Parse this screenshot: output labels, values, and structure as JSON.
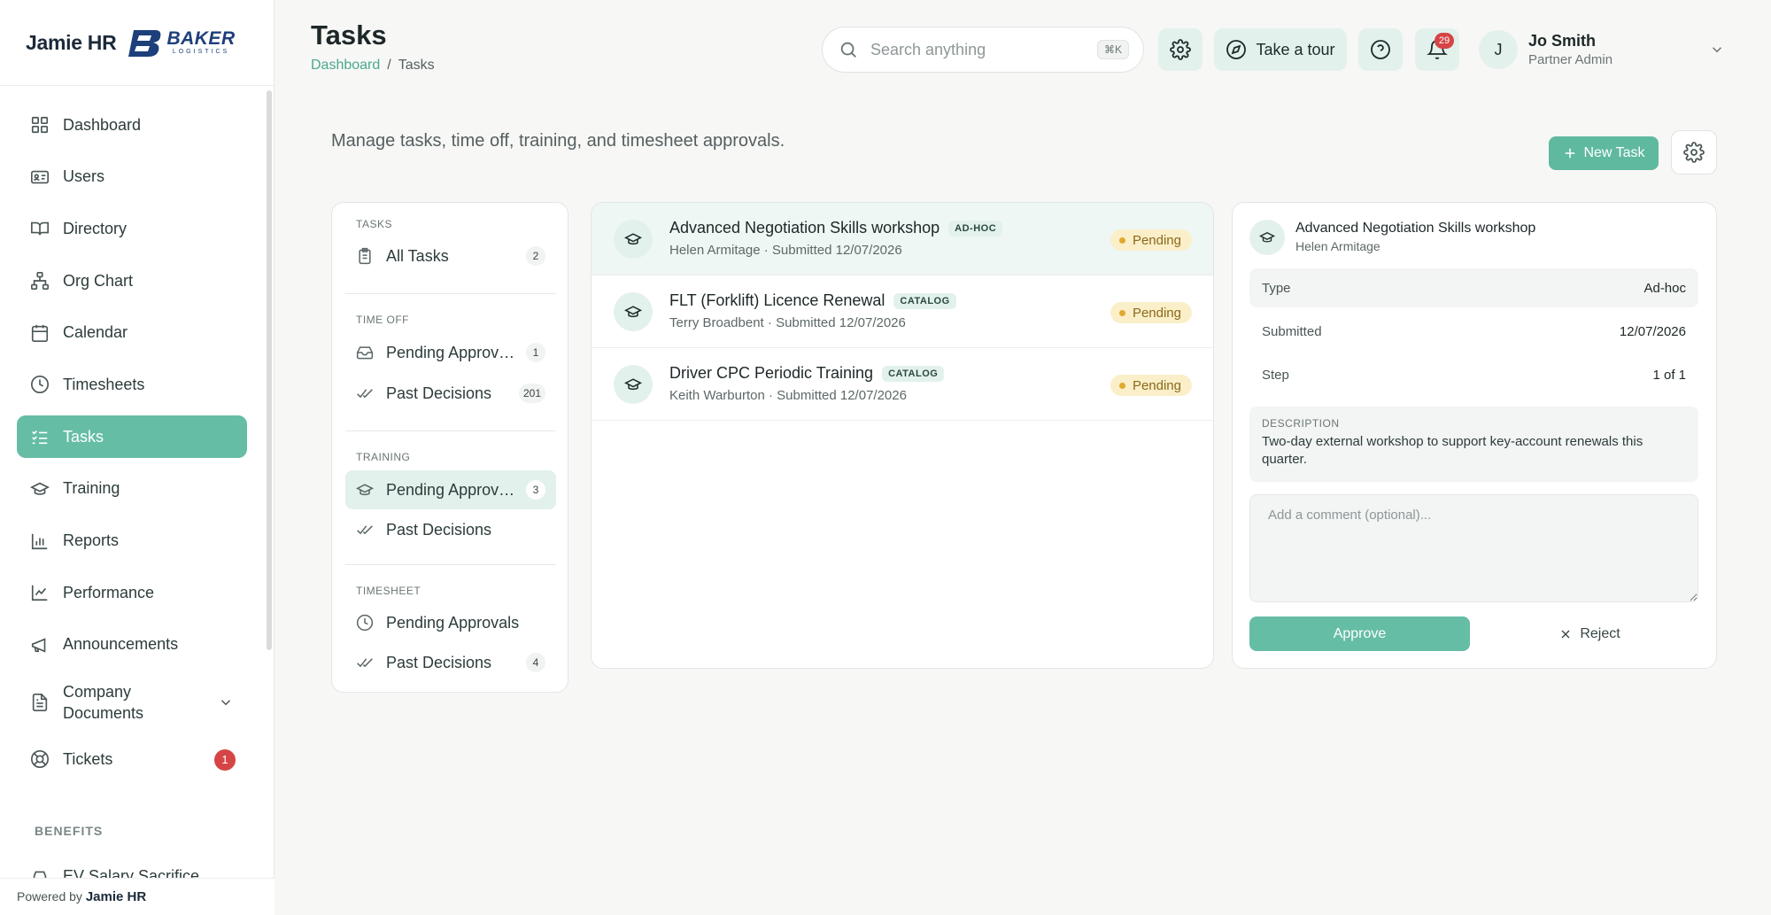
{
  "brand": {
    "name": "Jamie HR",
    "partner_logo_text": "BAKER",
    "partner_logo_sub": "LOGISTICS"
  },
  "sidebar": {
    "items": [
      {
        "label": "Dashboard",
        "icon": "dashboard-grid-icon"
      },
      {
        "label": "Users",
        "icon": "id-card-icon"
      },
      {
        "label": "Directory",
        "icon": "book-open-icon"
      },
      {
        "label": "Org Chart",
        "icon": "org-chart-icon"
      },
      {
        "label": "Calendar",
        "icon": "calendar-icon"
      },
      {
        "label": "Timesheets",
        "icon": "clock-icon"
      },
      {
        "label": "Tasks",
        "icon": "checklist-icon",
        "active": true
      },
      {
        "label": "Training",
        "icon": "graduation-cap-icon"
      },
      {
        "label": "Reports",
        "icon": "bar-chart-icon"
      },
      {
        "label": "Performance",
        "icon": "line-chart-icon"
      },
      {
        "label": "Announcements",
        "icon": "megaphone-icon"
      },
      {
        "label": "Company Documents",
        "icon": "document-icon"
      },
      {
        "label": "Tickets",
        "icon": "lifebuoy-icon",
        "badge": "1"
      }
    ],
    "benefits_label": "BENEFITS",
    "benefits_items": [
      {
        "label": "EV Salary Sacrifice",
        "icon": "car-icon"
      }
    ],
    "powered_by_prefix": "Powered by",
    "powered_by_name": "Jamie HR"
  },
  "header": {
    "title": "Tasks",
    "breadcrumb": {
      "parent": "Dashboard",
      "separator": "/",
      "current": "Tasks"
    },
    "search": {
      "placeholder": "Search anything",
      "shortcut": "⌘K"
    },
    "tour_label": "Take a tour",
    "notifications_count": "29",
    "user": {
      "initial": "J",
      "name": "Jo Smith",
      "role": "Partner Admin"
    }
  },
  "main": {
    "subtitle": "Manage tasks, time off, training, and timesheet approvals.",
    "new_task_label": "New Task"
  },
  "filters": {
    "sections": [
      {
        "label": "TASKS",
        "items": [
          {
            "label": "All Tasks",
            "count": "2",
            "icon": "clipboard-icon"
          }
        ]
      },
      {
        "label": "TIME OFF",
        "items": [
          {
            "label": "Pending Approvals",
            "count": "1",
            "icon": "inbox-icon"
          },
          {
            "label": "Past Decisions",
            "count": "201",
            "icon": "double-check-icon"
          }
        ]
      },
      {
        "label": "TRAINING",
        "items": [
          {
            "label": "Pending Approvals",
            "count": "3",
            "icon": "graduation-cap-icon",
            "active": true
          },
          {
            "label": "Past Decisions",
            "count": "",
            "icon": "double-check-icon"
          }
        ]
      },
      {
        "label": "TIMESHEET",
        "items": [
          {
            "label": "Pending Approvals",
            "count": "",
            "icon": "clock-icon"
          },
          {
            "label": "Past Decisions",
            "count": "4",
            "icon": "double-check-icon"
          }
        ]
      }
    ]
  },
  "tasks": [
    {
      "title": "Advanced Negotiation Skills workshop",
      "tag": "AD-HOC",
      "person": "Helen Armitage",
      "submitted": "Submitted 12/07/2026",
      "status": "Pending"
    },
    {
      "title": "FLT (Forklift) Licence Renewal",
      "tag": "CATALOG",
      "person": "Terry Broadbent",
      "submitted": "Submitted 12/07/2026",
      "status": "Pending"
    },
    {
      "title": "Driver CPC Periodic Training",
      "tag": "CATALOG",
      "person": "Keith Warburton",
      "submitted": "Submitted 12/07/2026",
      "status": "Pending"
    }
  ],
  "detail": {
    "title": "Advanced Negotiation Skills workshop",
    "person": "Helen Armitage",
    "rows": [
      {
        "key": "Type",
        "value": "Ad-hoc"
      },
      {
        "key": "Submitted",
        "value": "12/07/2026"
      },
      {
        "key": "Step",
        "value": "1 of 1"
      }
    ],
    "description_label": "DESCRIPTION",
    "description": "Two-day external workshop to support key-account renewals this quarter.",
    "comment_placeholder": "Add a comment (optional)...",
    "approve_label": "Approve",
    "reject_label": "Reject"
  },
  "colors": {
    "accent": "#66bda5",
    "accent_light": "#e3f1ec",
    "pending_bg": "#fbefc9",
    "badge_red": "#d64545"
  }
}
